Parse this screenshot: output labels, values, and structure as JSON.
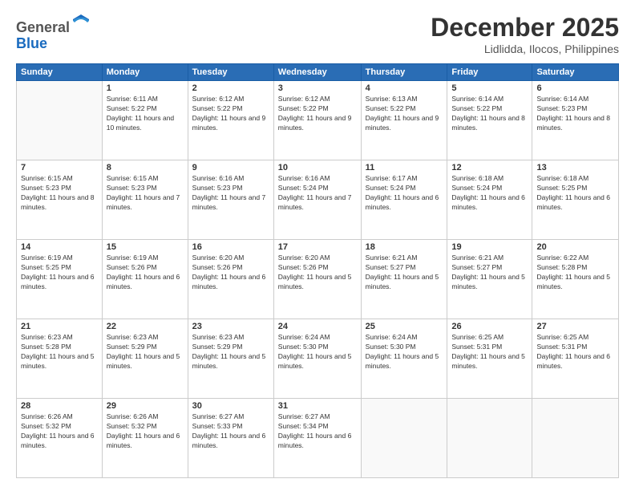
{
  "header": {
    "logo_general": "General",
    "logo_blue": "Blue",
    "month": "December 2025",
    "location": "Lidlidda, Ilocos, Philippines"
  },
  "weekdays": [
    "Sunday",
    "Monday",
    "Tuesday",
    "Wednesday",
    "Thursday",
    "Friday",
    "Saturday"
  ],
  "weeks": [
    [
      {
        "day": "",
        "sunrise": "",
        "sunset": "",
        "daylight": ""
      },
      {
        "day": "1",
        "sunrise": "6:11 AM",
        "sunset": "5:22 PM",
        "daylight": "11 hours and 10 minutes."
      },
      {
        "day": "2",
        "sunrise": "6:12 AM",
        "sunset": "5:22 PM",
        "daylight": "11 hours and 9 minutes."
      },
      {
        "day": "3",
        "sunrise": "6:12 AM",
        "sunset": "5:22 PM",
        "daylight": "11 hours and 9 minutes."
      },
      {
        "day": "4",
        "sunrise": "6:13 AM",
        "sunset": "5:22 PM",
        "daylight": "11 hours and 9 minutes."
      },
      {
        "day": "5",
        "sunrise": "6:14 AM",
        "sunset": "5:22 PM",
        "daylight": "11 hours and 8 minutes."
      },
      {
        "day": "6",
        "sunrise": "6:14 AM",
        "sunset": "5:23 PM",
        "daylight": "11 hours and 8 minutes."
      }
    ],
    [
      {
        "day": "7",
        "sunrise": "6:15 AM",
        "sunset": "5:23 PM",
        "daylight": "11 hours and 8 minutes."
      },
      {
        "day": "8",
        "sunrise": "6:15 AM",
        "sunset": "5:23 PM",
        "daylight": "11 hours and 7 minutes."
      },
      {
        "day": "9",
        "sunrise": "6:16 AM",
        "sunset": "5:23 PM",
        "daylight": "11 hours and 7 minutes."
      },
      {
        "day": "10",
        "sunrise": "6:16 AM",
        "sunset": "5:24 PM",
        "daylight": "11 hours and 7 minutes."
      },
      {
        "day": "11",
        "sunrise": "6:17 AM",
        "sunset": "5:24 PM",
        "daylight": "11 hours and 6 minutes."
      },
      {
        "day": "12",
        "sunrise": "6:18 AM",
        "sunset": "5:24 PM",
        "daylight": "11 hours and 6 minutes."
      },
      {
        "day": "13",
        "sunrise": "6:18 AM",
        "sunset": "5:25 PM",
        "daylight": "11 hours and 6 minutes."
      }
    ],
    [
      {
        "day": "14",
        "sunrise": "6:19 AM",
        "sunset": "5:25 PM",
        "daylight": "11 hours and 6 minutes."
      },
      {
        "day": "15",
        "sunrise": "6:19 AM",
        "sunset": "5:26 PM",
        "daylight": "11 hours and 6 minutes."
      },
      {
        "day": "16",
        "sunrise": "6:20 AM",
        "sunset": "5:26 PM",
        "daylight": "11 hours and 6 minutes."
      },
      {
        "day": "17",
        "sunrise": "6:20 AM",
        "sunset": "5:26 PM",
        "daylight": "11 hours and 5 minutes."
      },
      {
        "day": "18",
        "sunrise": "6:21 AM",
        "sunset": "5:27 PM",
        "daylight": "11 hours and 5 minutes."
      },
      {
        "day": "19",
        "sunrise": "6:21 AM",
        "sunset": "5:27 PM",
        "daylight": "11 hours and 5 minutes."
      },
      {
        "day": "20",
        "sunrise": "6:22 AM",
        "sunset": "5:28 PM",
        "daylight": "11 hours and 5 minutes."
      }
    ],
    [
      {
        "day": "21",
        "sunrise": "6:23 AM",
        "sunset": "5:28 PM",
        "daylight": "11 hours and 5 minutes."
      },
      {
        "day": "22",
        "sunrise": "6:23 AM",
        "sunset": "5:29 PM",
        "daylight": "11 hours and 5 minutes."
      },
      {
        "day": "23",
        "sunrise": "6:23 AM",
        "sunset": "5:29 PM",
        "daylight": "11 hours and 5 minutes."
      },
      {
        "day": "24",
        "sunrise": "6:24 AM",
        "sunset": "5:30 PM",
        "daylight": "11 hours and 5 minutes."
      },
      {
        "day": "25",
        "sunrise": "6:24 AM",
        "sunset": "5:30 PM",
        "daylight": "11 hours and 5 minutes."
      },
      {
        "day": "26",
        "sunrise": "6:25 AM",
        "sunset": "5:31 PM",
        "daylight": "11 hours and 5 minutes."
      },
      {
        "day": "27",
        "sunrise": "6:25 AM",
        "sunset": "5:31 PM",
        "daylight": "11 hours and 6 minutes."
      }
    ],
    [
      {
        "day": "28",
        "sunrise": "6:26 AM",
        "sunset": "5:32 PM",
        "daylight": "11 hours and 6 minutes."
      },
      {
        "day": "29",
        "sunrise": "6:26 AM",
        "sunset": "5:32 PM",
        "daylight": "11 hours and 6 minutes."
      },
      {
        "day": "30",
        "sunrise": "6:27 AM",
        "sunset": "5:33 PM",
        "daylight": "11 hours and 6 minutes."
      },
      {
        "day": "31",
        "sunrise": "6:27 AM",
        "sunset": "5:34 PM",
        "daylight": "11 hours and 6 minutes."
      },
      {
        "day": "",
        "sunrise": "",
        "sunset": "",
        "daylight": ""
      },
      {
        "day": "",
        "sunrise": "",
        "sunset": "",
        "daylight": ""
      },
      {
        "day": "",
        "sunrise": "",
        "sunset": "",
        "daylight": ""
      }
    ]
  ]
}
